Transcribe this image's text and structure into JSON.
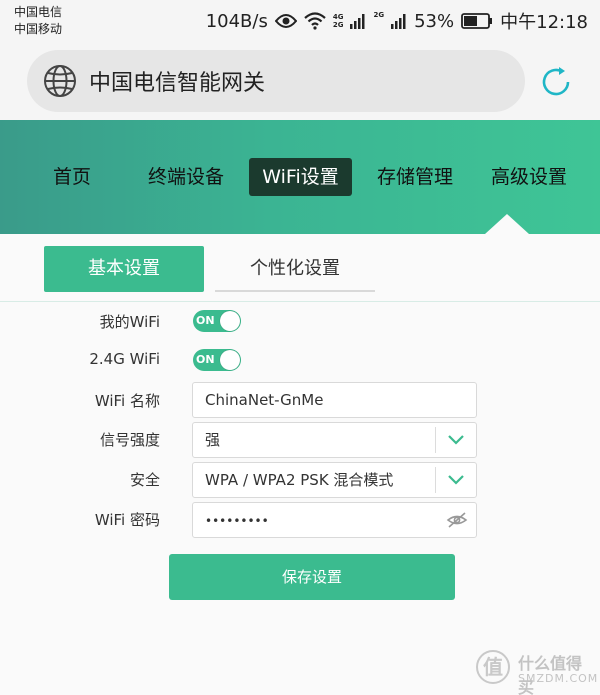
{
  "status_bar": {
    "carrier1": "中国电信",
    "carrier2": "中国移动",
    "speed": "104B/s",
    "net_tag1a": "4G",
    "net_tag1b": "2G",
    "net_tag2": "2G",
    "battery": "53%",
    "time": "中午12:18",
    "icons": [
      "eye-icon",
      "wifi-icon",
      "signal-icon",
      "battery-icon"
    ]
  },
  "address_bar": {
    "title": "中国电信智能网关",
    "icons": [
      "globe-icon",
      "reload-icon"
    ]
  },
  "nav": {
    "items": [
      {
        "label": "首页",
        "active": false
      },
      {
        "label": "终端设备",
        "active": false
      },
      {
        "label": "WiFi设置",
        "active": true
      },
      {
        "label": "存储管理",
        "active": false
      },
      {
        "label": "高级设置",
        "active": false
      }
    ]
  },
  "sub_tabs": {
    "basic": "基本设置",
    "custom": "个性化设置",
    "active": "basic"
  },
  "form": {
    "my_wifi": {
      "label": "我的WiFi",
      "toggle_text": "ON",
      "on": true
    },
    "wifi_24g": {
      "label": "2.4G WiFi",
      "toggle_text": "ON",
      "on": true
    },
    "wifi_name": {
      "label": "WiFi 名称",
      "value": "ChinaNet-GnMe"
    },
    "signal": {
      "label": "信号强度",
      "value": "强"
    },
    "security": {
      "label": "安全",
      "value": "WPA / WPA2 PSK 混合模式"
    },
    "password": {
      "label": "WiFi 密码",
      "value": "•••••••••"
    },
    "save_label": "保存设置"
  },
  "watermark": {
    "badge": "值",
    "line1": "什么值得买",
    "line2": "SMZDM.COM"
  },
  "colors": {
    "accent": "#3bbb8f",
    "nav_active": "#1b3a2e"
  }
}
